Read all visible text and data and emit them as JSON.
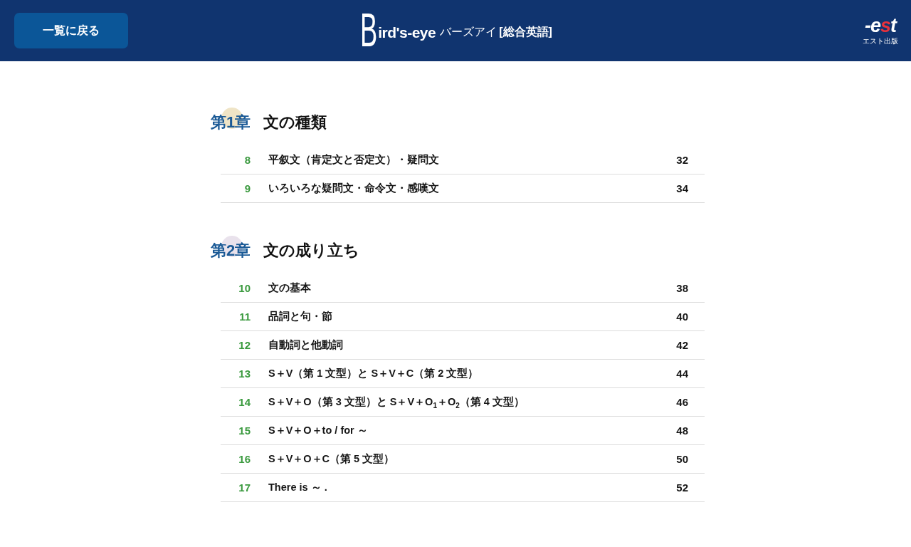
{
  "header": {
    "back_button": "一覧に戻る",
    "logo": {
      "initial": "B",
      "rest": "ird's-eye"
    },
    "subtitle": "バーズアイ",
    "subject": "[総合英語]",
    "publisher_logo": {
      "mark_parts": [
        {
          "text": "-e",
          "accent": false
        },
        {
          "text": "s",
          "accent": true
        },
        {
          "text": "t",
          "accent": false
        }
      ],
      "caption": "エスト出版"
    }
  },
  "chapters": [
    {
      "label": "第1章",
      "title": "文の種類",
      "color": "#efe4c6",
      "sections": [
        {
          "number": "8",
          "title": "平叙文（肯定文と否定文）・疑問文",
          "page": "32"
        },
        {
          "number": "9",
          "title": "いろいろな疑問文・命令文・感嘆文",
          "page": "34"
        }
      ]
    },
    {
      "label": "第2章",
      "title": "文の成り立ち",
      "color": "#e9e2ec",
      "sections": [
        {
          "number": "10",
          "title": "文の基本",
          "page": "38"
        },
        {
          "number": "11",
          "title": "品詞と句・節",
          "page": "40"
        },
        {
          "number": "12",
          "title": "自動詞と他動詞",
          "page": "42"
        },
        {
          "number": "13",
          "title": "S＋V（第 1 文型）と S＋V＋C（第 2 文型）",
          "page": "44"
        },
        {
          "number": "14",
          "title": "S＋V＋O（第 3 文型）と S＋V＋O$_{1}$＋O$_{2}$（第 4 文型）",
          "page": "46"
        },
        {
          "number": "15",
          "title": "S＋V＋O＋to / for ～",
          "page": "48"
        },
        {
          "number": "16",
          "title": "S＋V＋O＋C（第 5 文型）",
          "page": "50"
        },
        {
          "number": "17",
          "title": "There is ～ .",
          "page": "52"
        }
      ]
    }
  ]
}
